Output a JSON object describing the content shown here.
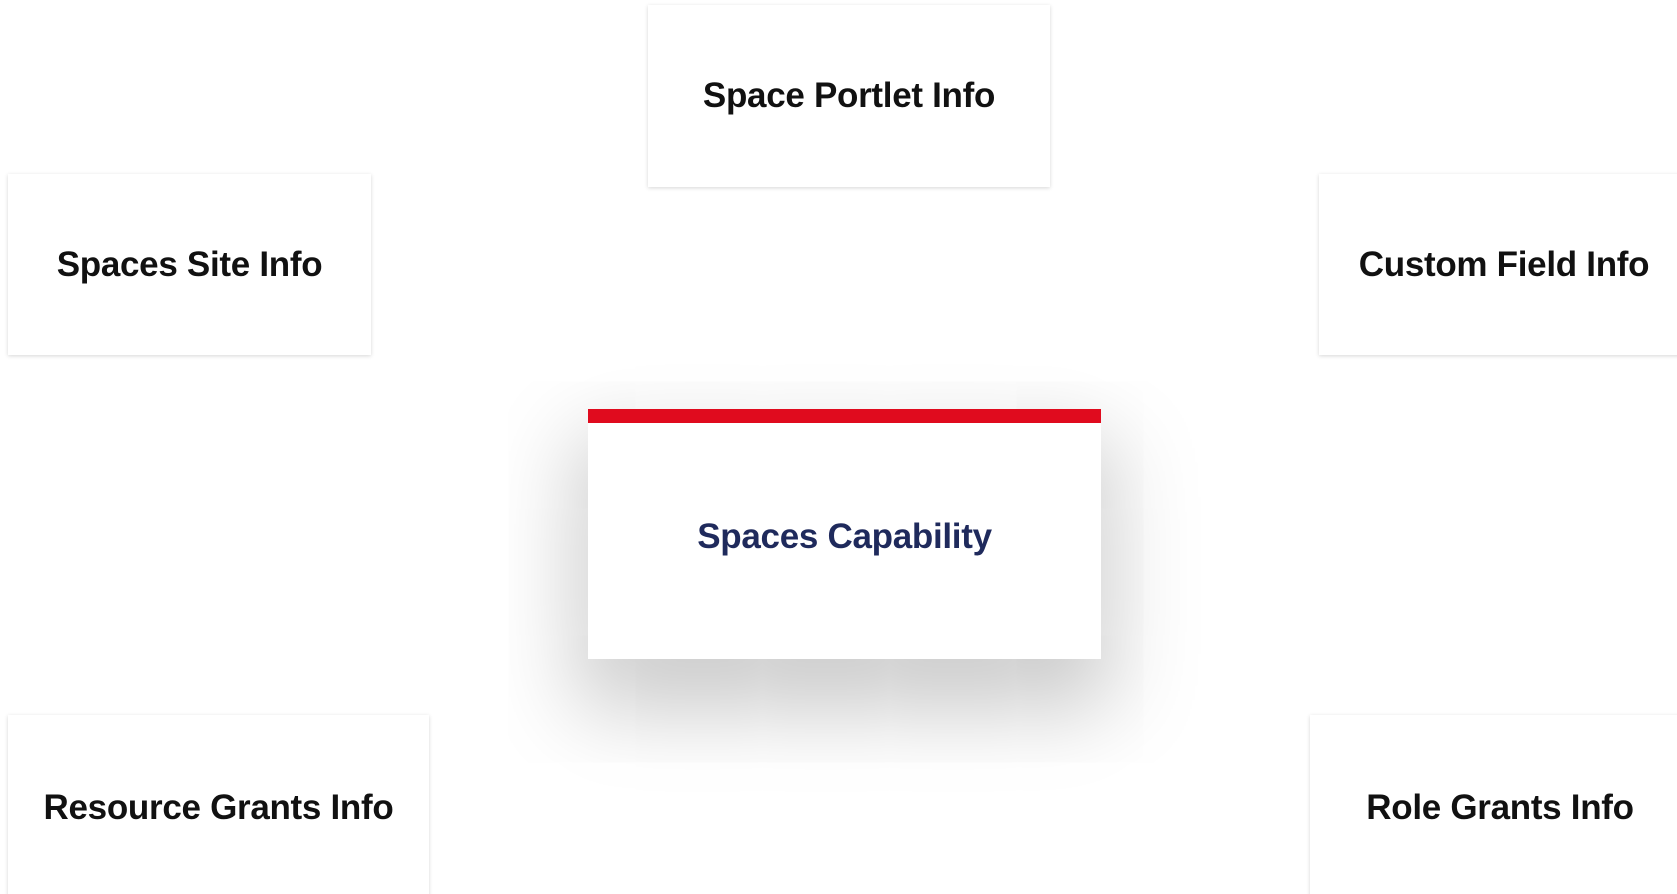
{
  "diagram": {
    "central_node": {
      "label": "Spaces Capability",
      "label_color": "#1f2a5c",
      "accent_color": "#e00b1e"
    },
    "nodes": [
      {
        "id": "portlet",
        "label": "Space Portlet Info"
      },
      {
        "id": "site",
        "label": "Spaces Site Info"
      },
      {
        "id": "custom",
        "label": "Custom Field Info"
      },
      {
        "id": "resource",
        "label": "Resource Grants Info"
      },
      {
        "id": "role",
        "label": "Role Grants Info"
      }
    ],
    "node_label_color": "#111111",
    "background_color": "#ffffff"
  }
}
